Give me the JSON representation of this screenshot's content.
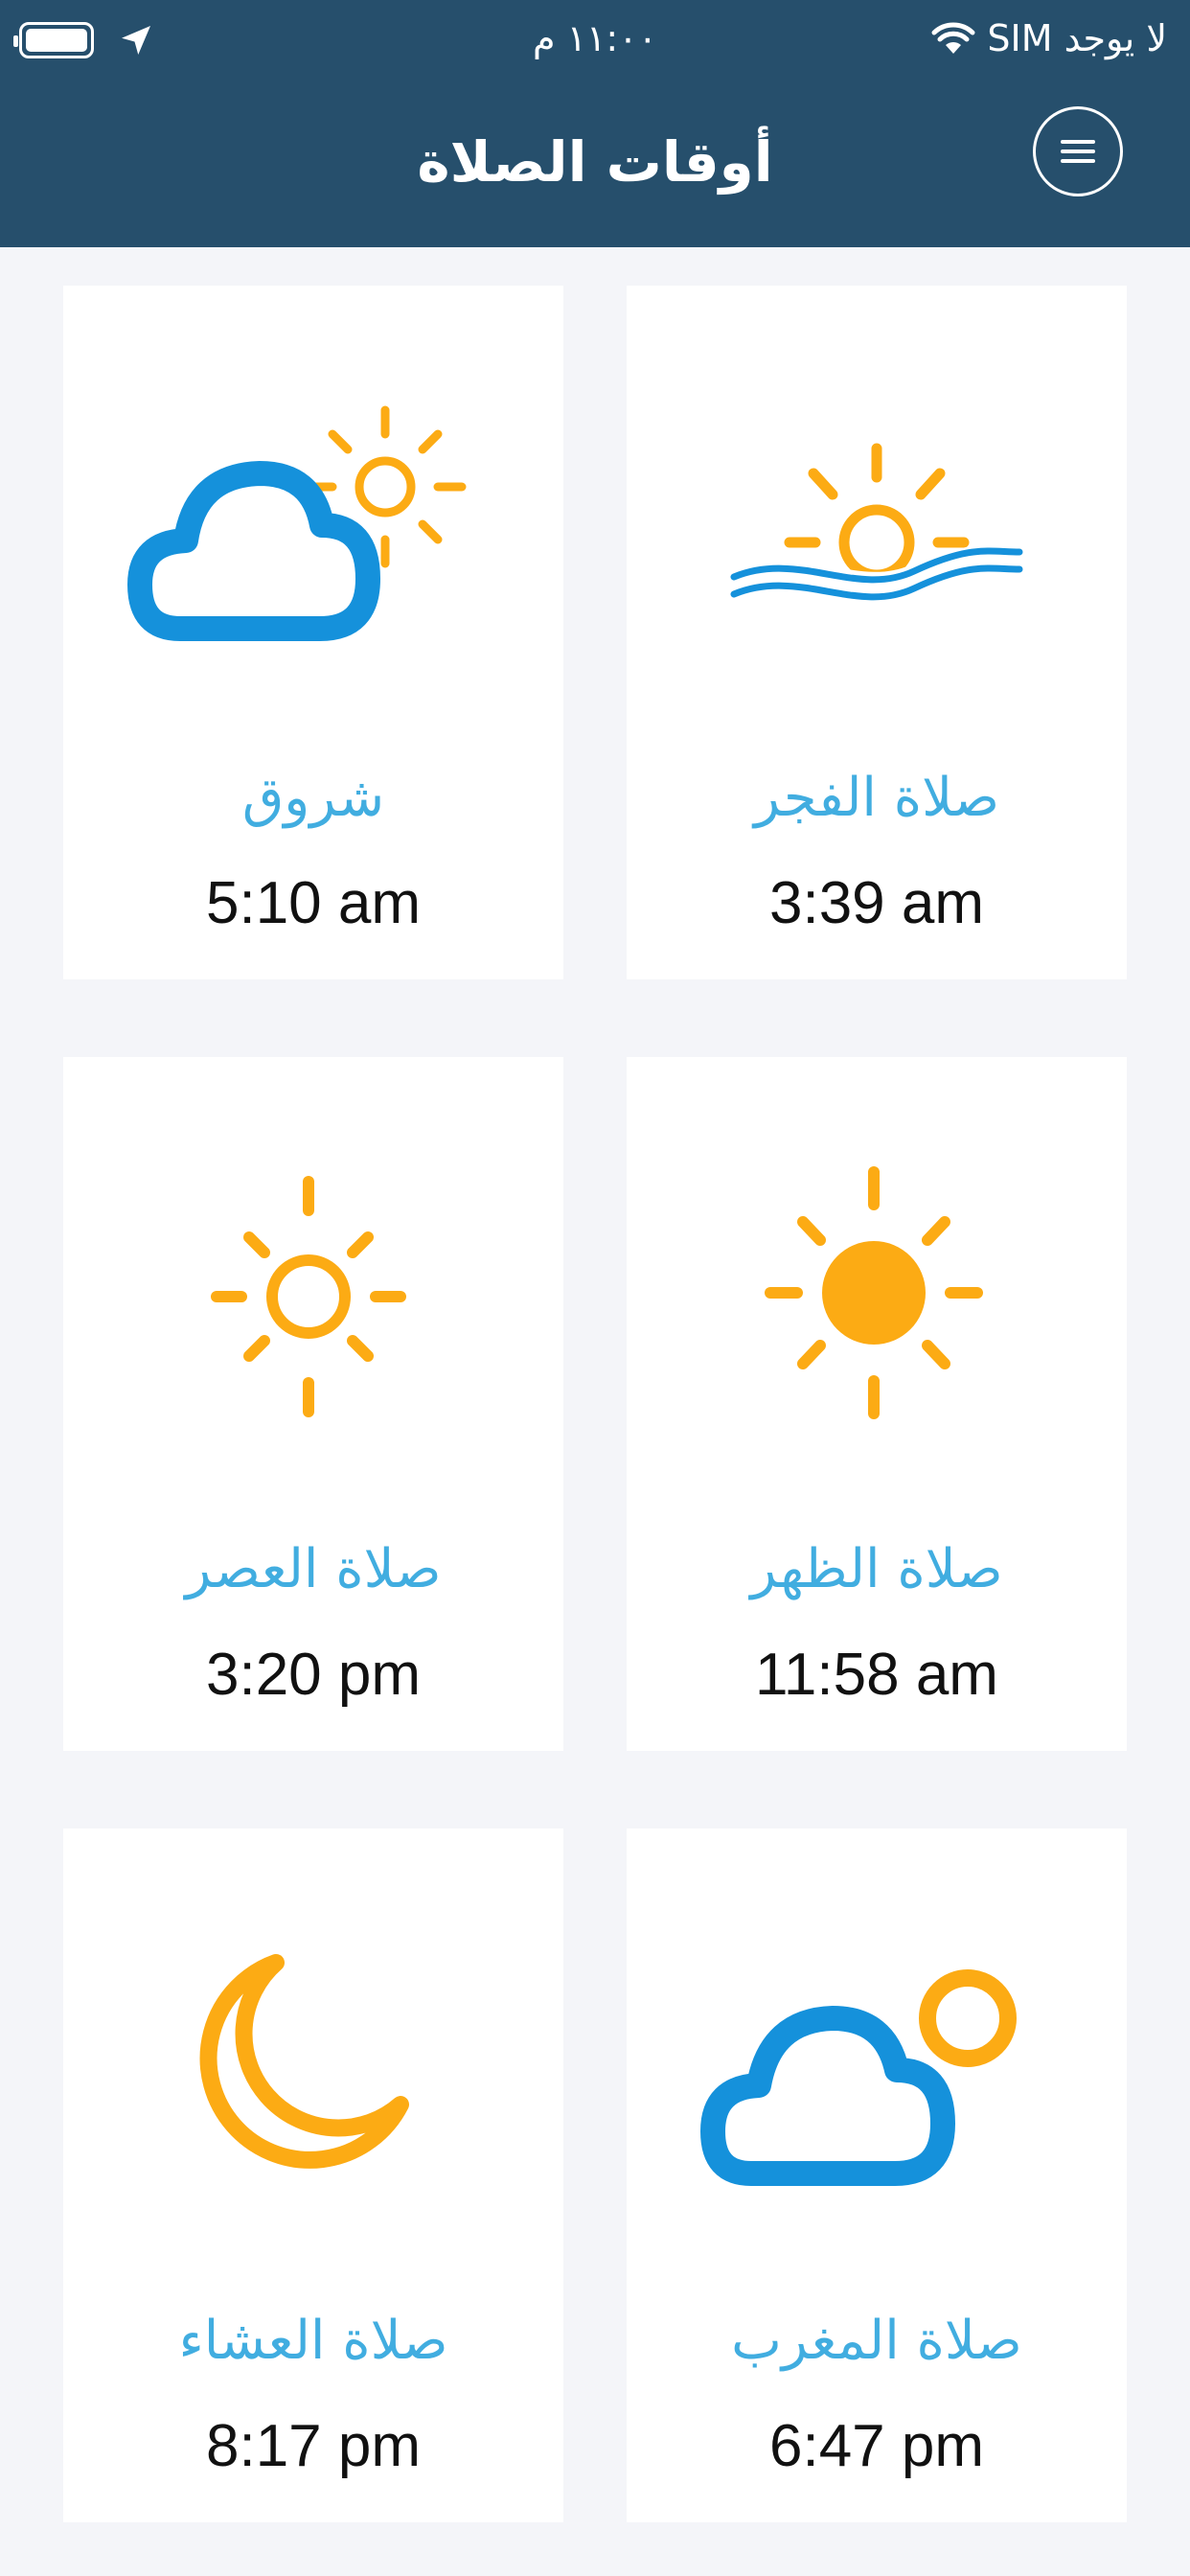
{
  "status_bar": {
    "carrier": "لا يوجد SIM",
    "time": "١١:٠٠ م"
  },
  "header": {
    "title": "أوقات الصلاة"
  },
  "prayers": [
    {
      "name": "صلاة الفجر",
      "time": "3:39 am",
      "icon": "sunrise-icon"
    },
    {
      "name": "شروق",
      "time": "5:10 am",
      "icon": "sun-cloud-icon"
    },
    {
      "name": "صلاة الظهر",
      "time": "11:58 am",
      "icon": "sun-icon"
    },
    {
      "name": "صلاة العصر",
      "time": "3:20 pm",
      "icon": "sun-outline-icon"
    },
    {
      "name": "صلاة المغرب",
      "time": "6:47 pm",
      "icon": "cloud-sun-icon"
    },
    {
      "name": "صلاة العشاء",
      "time": "8:17 pm",
      "icon": "moon-icon"
    }
  ],
  "colors": {
    "header": "#264f6c",
    "accent_blue": "#41ade0",
    "icon_orange": "#fcab14",
    "icon_blue": "#1591db",
    "background": "#f4f5f9"
  }
}
